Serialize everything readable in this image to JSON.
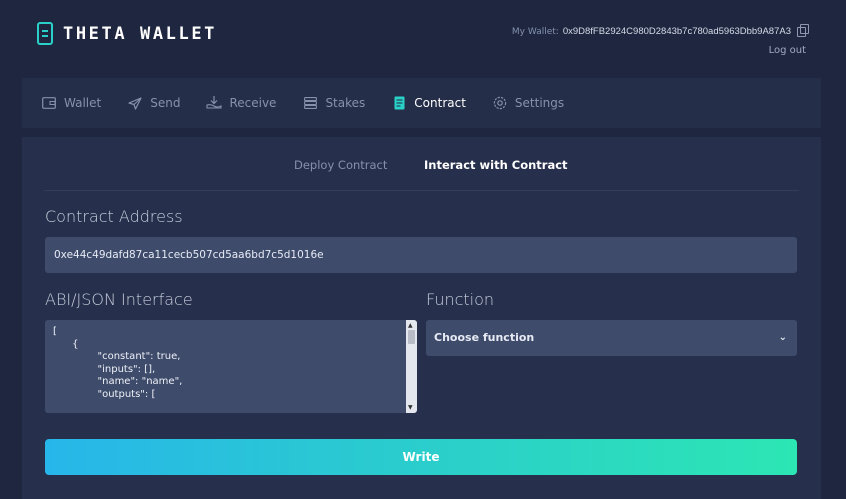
{
  "app": {
    "logo_text": "THETA WALLET"
  },
  "header": {
    "wallet_label": "My Wallet:",
    "wallet_address": "0x9D8fFB2924C980D2843b7c780ad5963Dbb9A87A3",
    "logout": "Log out"
  },
  "nav": {
    "items": [
      {
        "label": "Wallet",
        "icon": "wallet-icon"
      },
      {
        "label": "Send",
        "icon": "send-icon"
      },
      {
        "label": "Receive",
        "icon": "receive-icon"
      },
      {
        "label": "Stakes",
        "icon": "stakes-icon"
      },
      {
        "label": "Contract",
        "icon": "contract-icon",
        "active": true
      },
      {
        "label": "Settings",
        "icon": "settings-icon"
      }
    ]
  },
  "contract": {
    "tabs": {
      "deploy": "Deploy Contract",
      "interact": "Interact with Contract"
    },
    "address_label": "Contract Address",
    "address_value": "0xe44c49dafd87ca11cecb507cd5aa6bd7c5d1016e",
    "abi_label": "ABI/JSON Interface",
    "abi_text": "[\n      {\n              \"constant\": true,\n              \"inputs\": [],\n              \"name\": \"name\",\n              \"outputs\": [",
    "function_label": "Function",
    "function_value": "Choose function",
    "write_button": "Write"
  },
  "colors": {
    "accent": "#2ad1c9",
    "background": "#1f2740",
    "input": "#3e4b6b"
  }
}
